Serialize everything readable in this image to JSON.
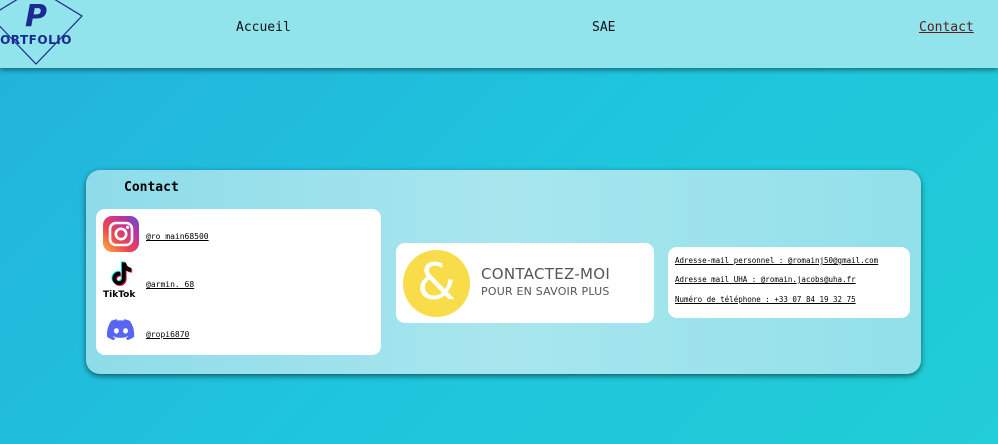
{
  "header": {
    "logo_letter": "P",
    "logo_text": "ORTFOLIO",
    "nav": [
      {
        "label": "Accueil"
      },
      {
        "label": "SAE"
      },
      {
        "label": "Contact"
      }
    ]
  },
  "contact": {
    "title": "Contact",
    "socials": [
      {
        "network": "instagram-icon",
        "handle": "@ro_main68500"
      },
      {
        "network": "tiktok-icon",
        "label": "TikTok",
        "handle": "@armin._68"
      },
      {
        "network": "discord-icon",
        "handle": "@ropi6870"
      }
    ],
    "banner": {
      "symbol": "&",
      "line1": "CONTACTEZ-MOI",
      "line2": "POUR EN SAVOIR PLUS"
    },
    "info": [
      "Adresse-mail personnel : @romainj50@gmail.com",
      "Adresse mail UHA : @romain.jacobs@uha.fr",
      "Numéro de téléphone : +33 07 84 19 32 75"
    ]
  },
  "colors": {
    "header_bg": "#91e3ec",
    "logo_blue": "#1a2a8f",
    "banner_yellow": "#f9dc4a",
    "discord": "#5865f2"
  }
}
